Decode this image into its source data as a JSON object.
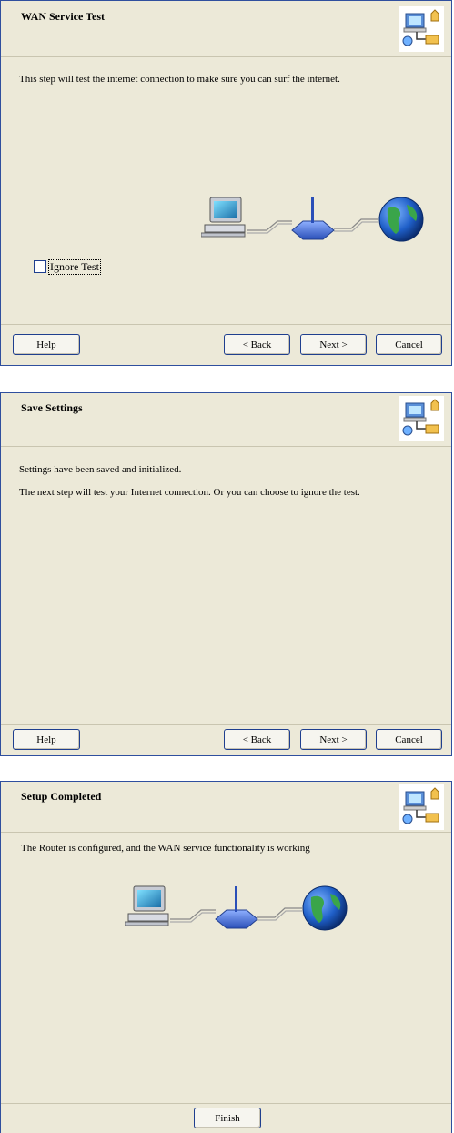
{
  "dialogs": [
    {
      "title": "WAN Service Test",
      "text": "This step will test the internet connection to make sure you can surf the internet.",
      "checkbox_label": "Ignore Test",
      "checkbox_checked": false,
      "buttons": {
        "help": "Help",
        "back": "< Back",
        "next": "Next >",
        "cancel": "Cancel"
      }
    },
    {
      "title": "Save Settings",
      "line1": "Settings have been saved and initialized.",
      "line2": "The next step will test your Internet connection. Or you can choose to ignore the test.",
      "buttons": {
        "help": "Help",
        "back": "< Back",
        "next": "Next >",
        "cancel": "Cancel"
      }
    },
    {
      "title": "Setup Completed",
      "text": "The Router is configured, and the WAN service functionality is working",
      "buttons": {
        "finish": "Finish"
      }
    }
  ],
  "icons": {
    "header_logo": "network-setup-icon",
    "computer": "computer-icon",
    "router": "router-icon",
    "globe": "globe-icon"
  },
  "colors": {
    "dialog_bg": "#ece9d8",
    "border": "#2f4f9e",
    "button_border": "#1f3f8f"
  }
}
